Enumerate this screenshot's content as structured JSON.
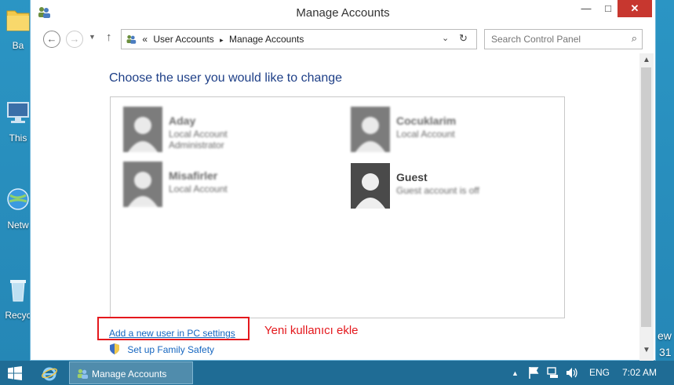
{
  "desktop": {
    "icons": [
      {
        "label": "Ba",
        "name": "folder"
      },
      {
        "label": "This",
        "name": "computer"
      },
      {
        "label": "Netw",
        "name": "network"
      },
      {
        "label": "Recyc",
        "name": "recycle-bin"
      }
    ],
    "right_text_1": "ew",
    "right_text_2": "31"
  },
  "window": {
    "title": "Manage Accounts",
    "minimize": "—",
    "maximize": "□",
    "close": "✕"
  },
  "navigation": {
    "back": "←",
    "forward": "→",
    "recent": "▼",
    "up": "↑",
    "breadcrumb_prefix": "«",
    "breadcrumb": [
      "User Accounts",
      "Manage Accounts"
    ],
    "separator": "▸",
    "address_dropdown": "⌄",
    "refresh": "↻",
    "search_placeholder": "Search Control Panel",
    "search_icon": "⌕"
  },
  "main": {
    "heading": "Choose the user you would like to change",
    "accounts": [
      {
        "name": "Aday",
        "type": "Local Account",
        "extra": "Administrator"
      },
      {
        "name": "Cocuklarim",
        "type": "Local Account"
      },
      {
        "name": "Misafirler",
        "type": "Local Account"
      },
      {
        "name": "Guest",
        "type": "Guest account is off"
      }
    ],
    "add_user_link": "Add a new user in PC settings",
    "family_safety_link": "Set up Family Safety",
    "annotation": "Yeni kullanıcı ekle",
    "highlight_color": "#e4181d"
  },
  "scrollbar": {
    "up": "▲",
    "down": "▼"
  },
  "taskbar": {
    "task_label": "Manage Accounts",
    "tray_arrow": "▲",
    "language": "ENG",
    "time": "7:02 AM"
  },
  "colors": {
    "desktop": "#2a8fbd",
    "taskbar": "#1f6c95",
    "link": "#1566c0",
    "heading": "#1e3f87",
    "close_button": "#c7372f"
  }
}
